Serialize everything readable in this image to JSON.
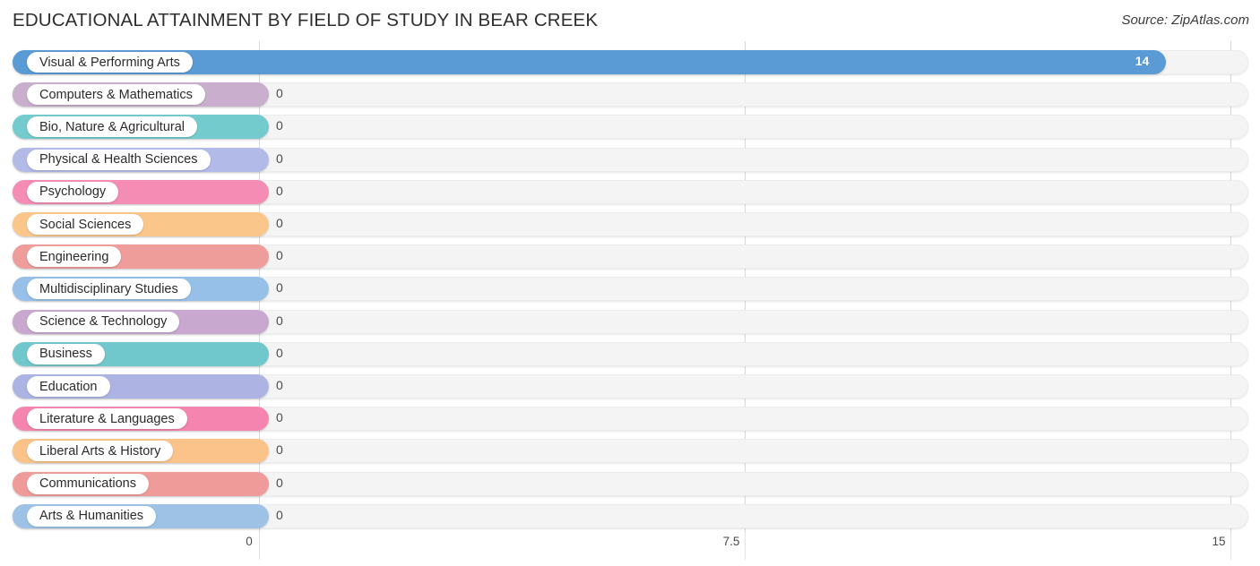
{
  "header": {
    "title": "EDUCATIONAL ATTAINMENT BY FIELD OF STUDY IN BEAR CREEK",
    "source": "Source: ZipAtlas.com"
  },
  "chart_data": {
    "type": "bar",
    "orientation": "horizontal",
    "title": "EDUCATIONAL ATTAINMENT BY FIELD OF STUDY IN BEAR CREEK",
    "xlabel": "",
    "ylabel": "",
    "xlim": [
      0,
      15
    ],
    "xticks": [
      0,
      7.5,
      15
    ],
    "xtick_labels": [
      "0",
      "7.5",
      "15"
    ],
    "grid": true,
    "legend": false,
    "categories": [
      "Visual & Performing Arts",
      "Computers & Mathematics",
      "Bio, Nature & Agricultural",
      "Physical & Health Sciences",
      "Psychology",
      "Social Sciences",
      "Engineering",
      "Multidisciplinary Studies",
      "Science & Technology",
      "Business",
      "Education",
      "Literature & Languages",
      "Liberal Arts & History",
      "Communications",
      "Arts & Humanities"
    ],
    "values": [
      14,
      0,
      0,
      0,
      0,
      0,
      0,
      0,
      0,
      0,
      0,
      0,
      0,
      0,
      0
    ],
    "value_labels": [
      "14",
      "0",
      "0",
      "0",
      "0",
      "0",
      "0",
      "0",
      "0",
      "0",
      "0",
      "0",
      "0",
      "0",
      "0"
    ],
    "colors": [
      "#5b9bd5",
      "#c9aecd",
      "#74cbce",
      "#b2bbe8",
      "#f58cb4",
      "#fbc68a",
      "#ee9d9b",
      "#96c0e8",
      "#c9a8d0",
      "#70c7cc",
      "#adb4e4",
      "#f585ae",
      "#fbc389",
      "#ef9b99",
      "#9dc2e6"
    ]
  },
  "axis": {
    "tick0": "0",
    "tick1": "7.5",
    "tick2": "15"
  }
}
